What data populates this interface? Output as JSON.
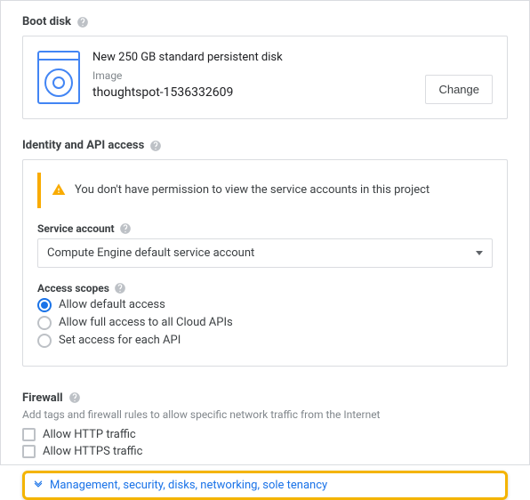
{
  "bootDisk": {
    "header": "Boot disk",
    "title": "New 250 GB standard persistent disk",
    "imageLabel": "Image",
    "imageName": "thoughtspot-1536332609",
    "changeLabel": "Change"
  },
  "identity": {
    "header": "Identity and API access",
    "warning": "You don't have permission to view the service accounts in this project",
    "serviceAccountLabel": "Service account",
    "serviceAccountValue": "Compute Engine default service account",
    "accessScopesLabel": "Access scopes",
    "scopes": {
      "default": "Allow default access",
      "full": "Allow full access to all Cloud APIs",
      "perApi": "Set access for each API"
    }
  },
  "firewall": {
    "header": "Firewall",
    "sub": "Add tags and firewall rules to allow specific network traffic from the Internet",
    "http": "Allow HTTP traffic",
    "https": "Allow HTTPS traffic"
  },
  "expander": {
    "label": "Management, security, disks, networking, sole tenancy"
  }
}
